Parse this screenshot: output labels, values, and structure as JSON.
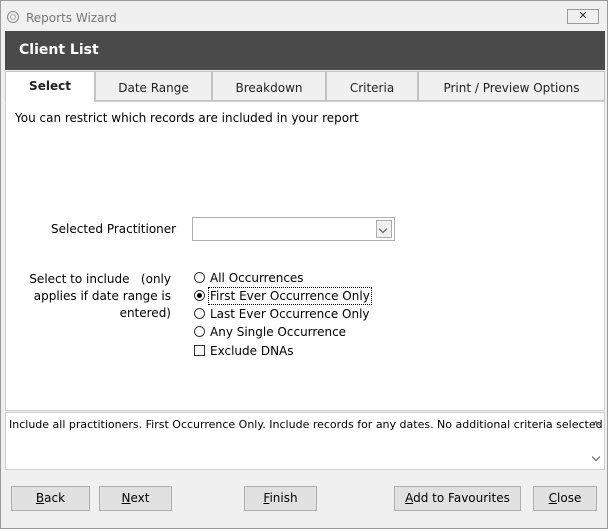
{
  "window": {
    "title": "Reports Wizard",
    "close_glyph": "✕",
    "icon": "app-icon"
  },
  "header": {
    "title": "Client List"
  },
  "tabs": [
    {
      "label": "Select",
      "active": true
    },
    {
      "label": "Date Range",
      "active": false
    },
    {
      "label": "Breakdown",
      "active": false
    },
    {
      "label": "Criteria",
      "active": false
    },
    {
      "label": "Print / Preview Options",
      "active": false
    }
  ],
  "select_panel": {
    "intro": "You can restrict which records are included in your report",
    "practitioner_label": "Selected Practitioner",
    "practitioner_value": "",
    "include_label_line1": "Select to include   (only",
    "include_label_line2": "applies if date range is",
    "include_label_line3": "entered)",
    "options": [
      {
        "label": "All Occurrences",
        "checked": false
      },
      {
        "label": "First Ever Occurrence Only",
        "checked": true
      },
      {
        "label": "Last Ever Occurrence Only",
        "checked": false
      },
      {
        "label": "Any Single Occurrence",
        "checked": false
      }
    ],
    "exclude_dnas": {
      "label": "Exclude DNAs",
      "checked": false
    }
  },
  "summary": {
    "text": "Include all practitioners. First Occurrence Only. Include records for any dates. No additional criteria selected"
  },
  "buttons": {
    "back": {
      "mnemonic": "B",
      "rest": "ack"
    },
    "next": {
      "mnemonic": "N",
      "rest": "ext"
    },
    "finish": {
      "mnemonic": "F",
      "rest": "inish"
    },
    "favourites": {
      "mnemonic": "A",
      "rest": "dd to Favourites"
    },
    "close": {
      "mnemonic": "C",
      "rest": "lose"
    }
  }
}
